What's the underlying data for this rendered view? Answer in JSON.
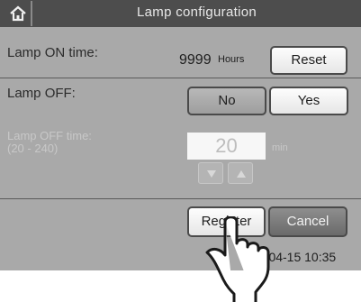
{
  "header": {
    "title": "Lamp configuration",
    "home_icon": "home-icon"
  },
  "lamp_on": {
    "label": "Lamp ON time:",
    "hours": "9999",
    "unit": "Hours",
    "reset_label": "Reset"
  },
  "lamp_off": {
    "label": "Lamp OFF:",
    "no_label": "No",
    "yes_label": "Yes",
    "selected": "No"
  },
  "off_time": {
    "label_line1": "Lamp OFF time:",
    "label_line2": "(20 - 240)",
    "value": "20",
    "unit": "min"
  },
  "actions": {
    "register_label": "Register",
    "cancel_label": "Cancel"
  },
  "status": {
    "datetime": "2-04-15 10:35"
  }
}
